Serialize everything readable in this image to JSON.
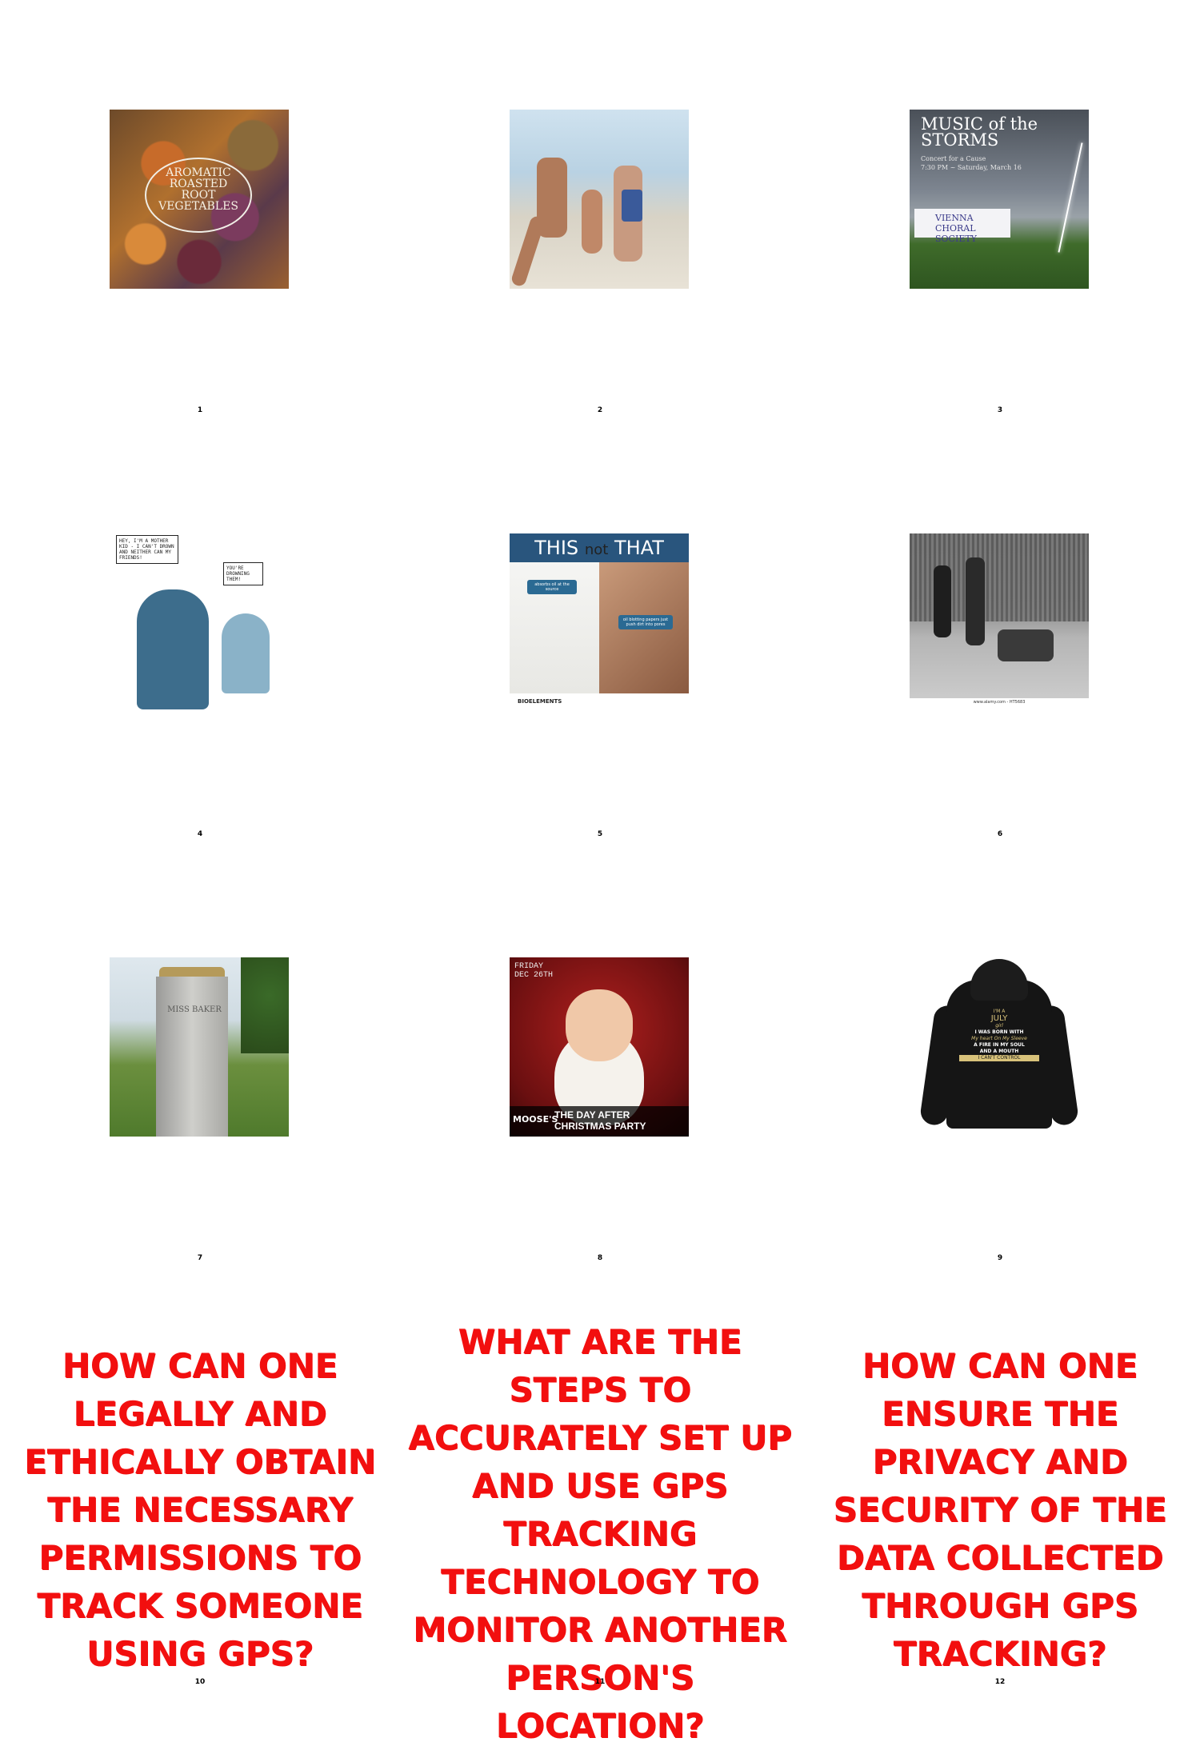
{
  "cells": [
    {
      "number": "1",
      "caption_lines": [
        "AROMATIC",
        "ROASTED",
        "ROOT",
        "VEGETABLES"
      ]
    },
    {
      "number": "2"
    },
    {
      "number": "3",
      "title_lines": [
        "MUSIC of the",
        "STORMS"
      ],
      "subtitle": "Concert for a Cause",
      "date": "7:30 PM ~ Saturday, March 16",
      "banner": "VIENNA CHORAL SOCIETY"
    },
    {
      "number": "4",
      "bubble_left": "HEY, I'M A MOTHER KID - I CAN'T DROWN AND NEITHER CAN MY FRIENDS!",
      "bubble_right": "YOU'RE DROWNING THEM!"
    },
    {
      "number": "5",
      "title_this": "THIS",
      "title_not": "not",
      "title_that": "THAT",
      "tag_left": "absorbs oil at the source",
      "tag_right": "oil blotting papers just push dirt into pores",
      "brand": "BIOELEMENTS"
    },
    {
      "number": "6",
      "watermark": "www.alamy.com - HT5683"
    },
    {
      "number": "7",
      "inscription": "MISS BAKER"
    },
    {
      "number": "8",
      "date_lines": [
        "FRIDAY",
        "DEC 26TH"
      ],
      "headline": "THE DAY AFTER CHRISTMAS PARTY",
      "brand": "MOOSE'S"
    },
    {
      "number": "9",
      "print_lines": [
        "I'M A",
        "JULY",
        "girl",
        "I WAS BORN WITH",
        "My heart On My Sleeve",
        "A FIRE IN MY SOUL",
        "AND A MOUTH",
        "I CAN'T CONTROL"
      ]
    },
    {
      "number": "10",
      "question": "HOW CAN ONE LEGALLY AND ETHICALLY OBTAIN THE NECESSARY PERMISSIONS TO TRACK SOMEONE USING GPS?"
    },
    {
      "number": "11",
      "question": "WHAT ARE THE STEPS TO ACCURATELY SET UP AND USE GPS TRACKING TECHNOLOGY TO MONITOR ANOTHER PERSON'S LOCATION?"
    },
    {
      "number": "12",
      "question": "HOW CAN ONE ENSURE THE PRIVACY AND SECURITY OF THE DATA COLLECTED THROUGH GPS TRACKING?"
    }
  ],
  "colors": {
    "question_text": "#f20f0f"
  }
}
